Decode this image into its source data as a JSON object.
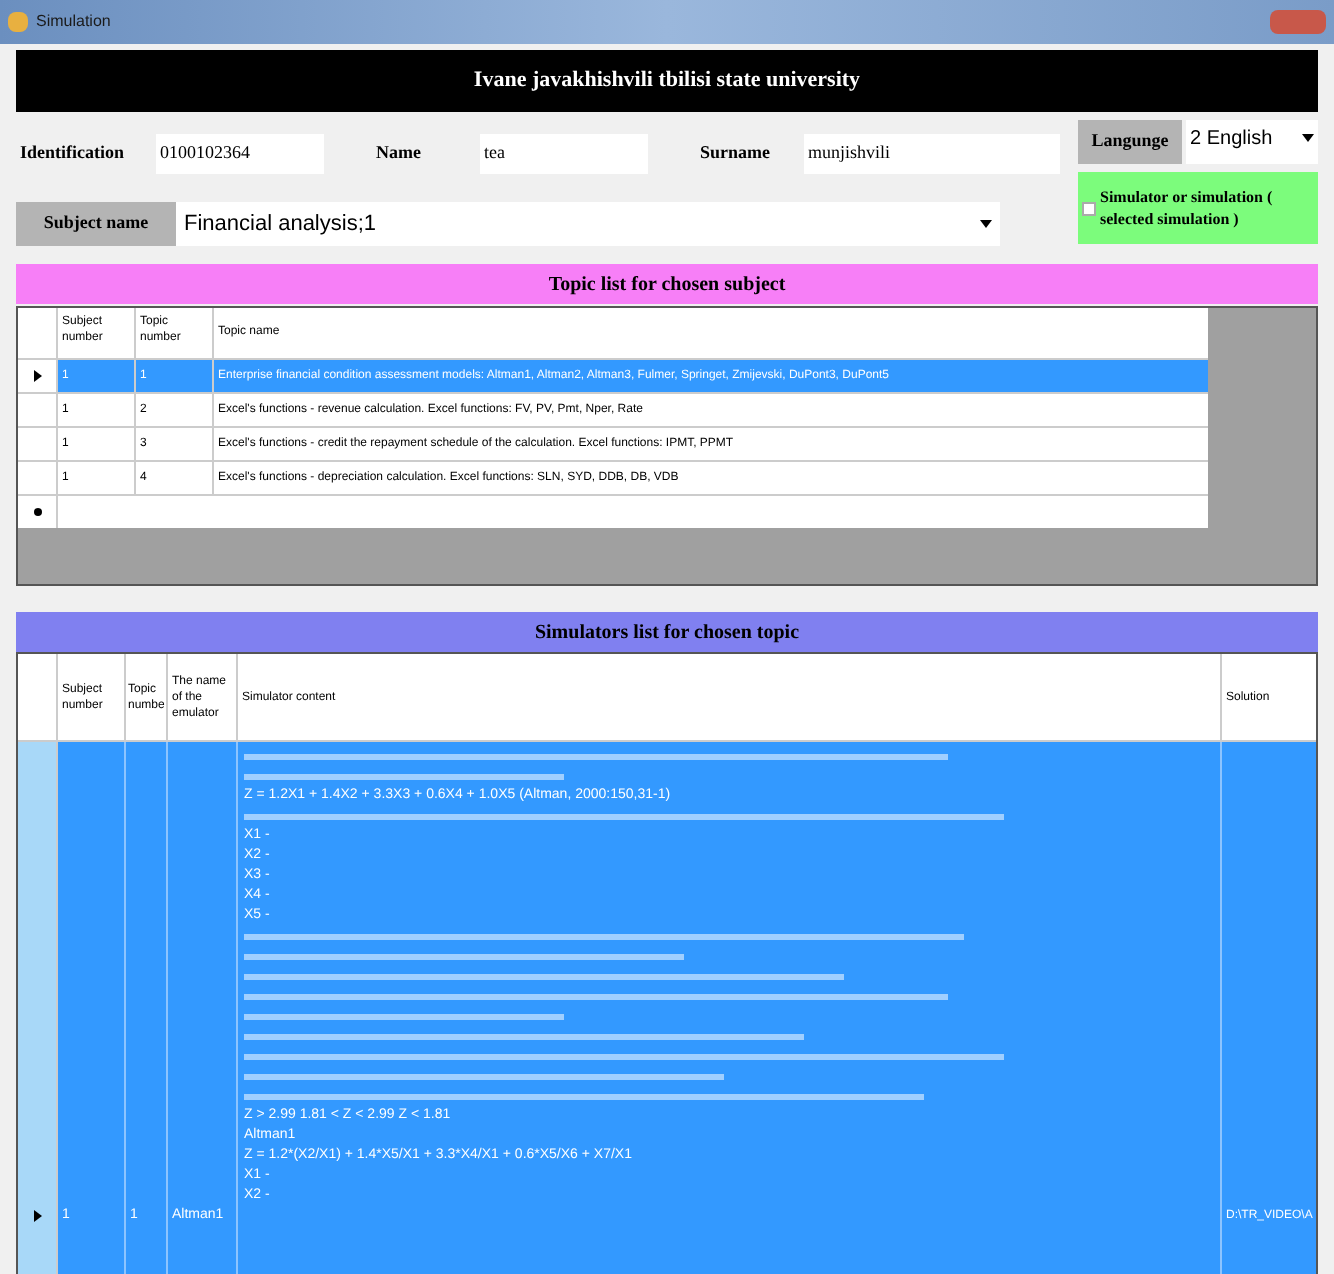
{
  "window": {
    "title": "Simulation"
  },
  "header": "Ivane javakhishvili tbilisi state university",
  "fields": [
    {
      "label": "Identification",
      "value": "0100102364"
    },
    {
      "label": "Name",
      "value": "tea"
    },
    {
      "label": "Surname",
      "value": "munjishvili"
    }
  ],
  "language": {
    "label": "Langunge",
    "value": "2 English"
  },
  "subject": {
    "label": "Subject name",
    "value": "Financial analysis;1"
  },
  "mode_checkbox": {
    "label": "Simulator or simulation ( selected simulation )",
    "checked": false
  },
  "topics": {
    "title": "Topic list for chosen subject",
    "columns": [
      "Subject number",
      "Topic number",
      "Topic name"
    ],
    "rows": [
      {
        "cells": [
          "1",
          "1",
          "Enterprise financial condition assessment models: Altman1, Altman2, Altman3, Fulmer, Springet, Zmijevski, DuPont3, DuPont5"
        ],
        "selected": true
      },
      {
        "cells": [
          "1",
          "2",
          "Excel's functions - revenue calculation. Excel functions: FV, PV, Pmt, Nper, Rate"
        ],
        "selected": false
      },
      {
        "cells": [
          "1",
          "3",
          "Excel's functions - credit the repayment schedule of the calculation. Excel functions: IPMT, PPMT"
        ],
        "selected": false
      },
      {
        "cells": [
          "1",
          "4",
          "Excel's functions - depreciation calculation. Excel functions: SLN, SYD, DDB, DB, VDB"
        ],
        "selected": false
      }
    ]
  },
  "simulators": {
    "title": "Simulators list for chosen topic",
    "columns": [
      "Subject number",
      "Topic numbe",
      "The name of the emulator",
      "Simulator content",
      "Solution"
    ],
    "rows": [
      {
        "cells": [
          "1",
          "1",
          "Altman1"
        ],
        "solution": "D:\\TR_VIDEO\\A",
        "selected": true,
        "content": [
          {
            "kind": "scribble"
          },
          {
            "kind": "scribble"
          },
          {
            "kind": "text",
            "text": "Z = 1.2X1 + 1.4X2 + 3.3X3 + 0.6X4 + 1.0X5  (Altman, 2000:150,31-1)"
          },
          {
            "kind": "scribble"
          },
          {
            "kind": "text",
            "text": "X1 -"
          },
          {
            "kind": "text",
            "text": "X2 -"
          },
          {
            "kind": "text",
            "text": "X3 -"
          },
          {
            "kind": "text",
            "text": "X4 -"
          },
          {
            "kind": "text",
            "text": "X5 -"
          },
          {
            "kind": "scribble"
          },
          {
            "kind": "scribble"
          },
          {
            "kind": "scribble"
          },
          {
            "kind": "scribble"
          },
          {
            "kind": "scribble"
          },
          {
            "kind": "scribble"
          },
          {
            "kind": "scribble"
          },
          {
            "kind": "scribble"
          },
          {
            "kind": "scribble"
          },
          {
            "kind": "text",
            "text": "Z > 2.99    1.81 < Z < 2.99    Z < 1.81"
          },
          {
            "kind": "text",
            "text": "Altman1"
          },
          {
            "kind": "text",
            "text": "Z = 1.2*(X2/X1) + 1.4*X5/X1 + 3.3*X4/X1 + 0.6*X5/X6 + X7/X1"
          },
          {
            "kind": "text",
            "text": "X1 -"
          },
          {
            "kind": "text",
            "text": "X2 -"
          }
        ]
      }
    ]
  }
}
